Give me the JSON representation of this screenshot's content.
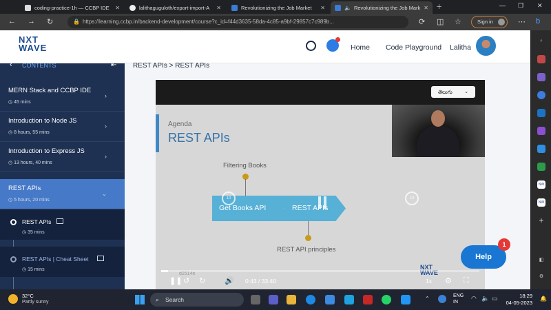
{
  "browser": {
    "tabs": [
      {
        "title": "coding-practice-1h — CCBP IDE"
      },
      {
        "title": "lalithaguguloth/export-import-A"
      },
      {
        "title": "Revolutionizing the Job Market"
      },
      {
        "title": "Revolutionizing the Job Mark"
      }
    ],
    "url": "https://learning.ccbp.in/backend-development/course?c_id=f44d3635-58da-4c85-a9bf-29857c7c989b...",
    "signin_label": "Sign in"
  },
  "header": {
    "logo_top": "NXT",
    "logo_bottom": "WAVE",
    "nav": {
      "home": "Home",
      "playground": "Code Playground"
    },
    "user_name": "Lalitha"
  },
  "sidebar": {
    "contents_label": "CONTENTS",
    "modules": [
      {
        "title": "MERN Stack and CCBP IDE",
        "duration": "45 mins"
      },
      {
        "title": "Introduction to Node JS",
        "duration": "8 hours, 55 mins"
      },
      {
        "title": "Introduction to Express JS",
        "duration": "13 hours, 40 mins"
      },
      {
        "title": "REST APIs",
        "duration": "5 hours, 20 mins"
      }
    ],
    "subitems": [
      {
        "title": "REST APIs",
        "duration": "35 mins"
      },
      {
        "title": "REST APIs | Cheat Sheet",
        "duration": "15 mins"
      }
    ]
  },
  "main": {
    "breadcrumb": "REST APIs > REST APIs"
  },
  "video": {
    "language": "తెలుగు",
    "slide_heading": "Agenda",
    "slide_title": "REST APIs",
    "label_top": "Filtering Books",
    "arrow1": "Get Books API",
    "arrow2": "REST APIs",
    "label_bottom": "REST API principles",
    "watermark": "d2514e",
    "current_time": "0:43",
    "time_sep": "/",
    "duration": "33:40",
    "speed": "1x",
    "progress": 0.021,
    "logo_top": "NXT",
    "logo_bottom": "WAVE"
  },
  "help": {
    "label": "Help",
    "badge": "1"
  },
  "taskbar": {
    "temp": "32°C",
    "weather": "Partly sunny",
    "search_label": "Search",
    "lang_top": "ENG",
    "lang_bottom": "IN",
    "time": "18:29",
    "date": "04-05-2023"
  }
}
